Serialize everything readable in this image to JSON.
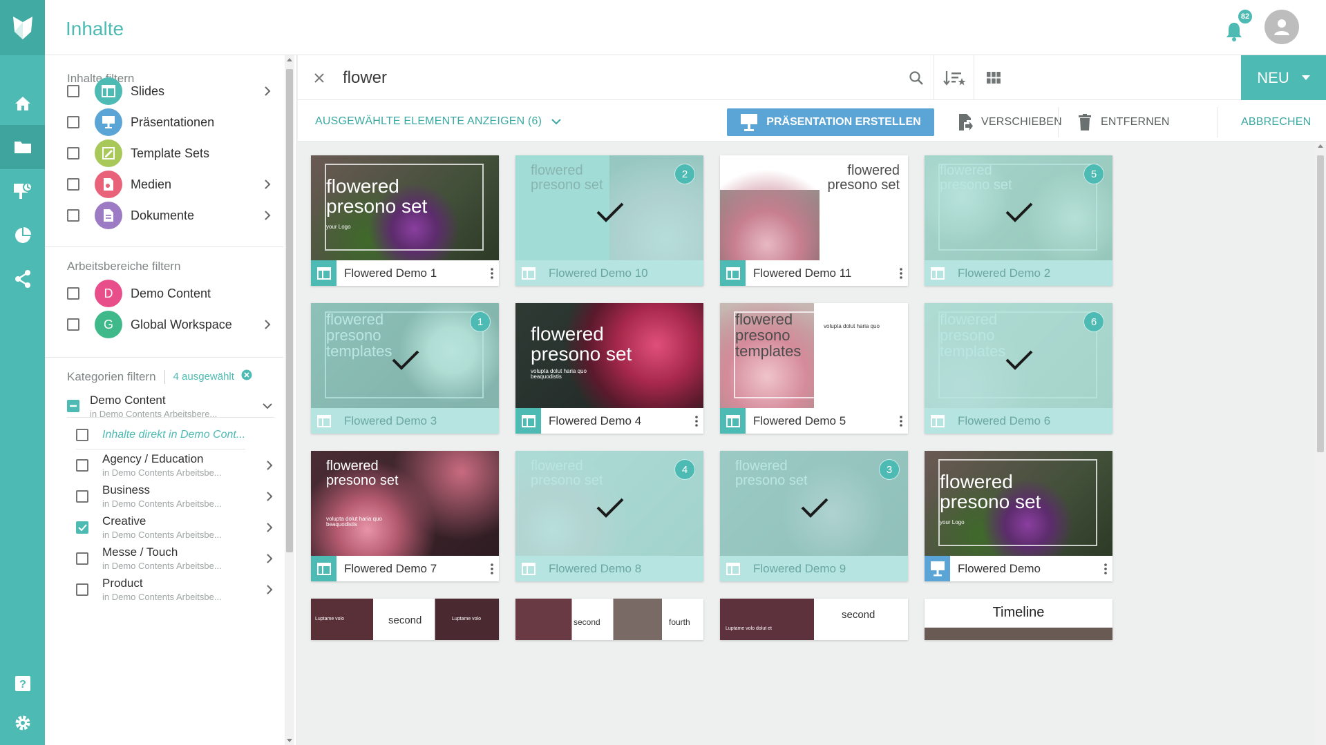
{
  "header": {
    "title": "Inhalte",
    "notification_count": "82"
  },
  "colors": {
    "accent": "#4dbab3",
    "primary_blue": "#5ba5d6",
    "selected_footer": "#b6e4e0"
  },
  "rail": {
    "icons": [
      "logo-icon",
      "home-icon",
      "folder-icon",
      "presentation-icon",
      "pie-chart-icon",
      "share-icon",
      "help-icon",
      "settings-icon"
    ]
  },
  "filters": {
    "content_title": "Inhalte filtern",
    "types": [
      {
        "label": "Slides",
        "color": "#4dbab3",
        "has_arrow": true
      },
      {
        "label": "Präsentationen",
        "color": "#5ba5d6",
        "has_arrow": false
      },
      {
        "label": "Template Sets",
        "color": "#a8c85a",
        "has_arrow": false
      },
      {
        "label": "Medien",
        "color": "#e8627a",
        "has_arrow": true
      },
      {
        "label": "Dokumente",
        "color": "#9c7bc4",
        "has_arrow": true
      }
    ],
    "workspace_title": "Arbeitsbereiche filtern",
    "workspaces": [
      {
        "label": "Demo Content",
        "letter": "D",
        "color": "#e84f8a",
        "has_arrow": false
      },
      {
        "label": "Global Workspace",
        "letter": "G",
        "color": "#3fb88a",
        "has_arrow": true
      }
    ],
    "category_title": "Kategorien filtern",
    "category_selected": "4 ausgewählt",
    "category_parent": {
      "name": "Demo Content",
      "sub": "in Demo Contents Arbeitsbere..."
    },
    "category_direct": "Inhalte direkt in Demo Cont...",
    "categories": [
      {
        "name": "Agency / Education",
        "sub": "in Demo Contents Arbeitsbe...",
        "checked": false
      },
      {
        "name": "Business",
        "sub": "in Demo Contents Arbeitsbe...",
        "checked": false
      },
      {
        "name": "Creative",
        "sub": "in Demo Contents Arbeitsbe...",
        "checked": true
      },
      {
        "name": "Messe / Touch",
        "sub": "in Demo Contents Arbeitsbe...",
        "checked": false
      },
      {
        "name": "Product",
        "sub": "in Demo Contents Arbeitsbe...",
        "checked": false
      }
    ]
  },
  "search": {
    "value": "flower",
    "new_label": "NEU"
  },
  "actions": {
    "show_selected": "AUSGEWÄHLTE ELEMENTE ANZEIGEN (6)",
    "create_presentation": "PRÄSENTATION ERSTELLEN",
    "move": "VERSCHIEBEN",
    "remove": "ENTFERNEN",
    "cancel": "ABBRECHEN"
  },
  "cards": [
    {
      "title": "Flowered Demo 1",
      "kind": "slide",
      "selected": false,
      "order": "",
      "thumb": "a",
      "text": [
        "flowered",
        "presono set"
      ],
      "small": "your Logo"
    },
    {
      "title": "Flowered Demo 10",
      "kind": "slide",
      "selected": true,
      "order": "2",
      "thumb": "b",
      "text": [
        "flowered",
        "presono set"
      ],
      "small": ""
    },
    {
      "title": "Flowered Demo 11",
      "kind": "slide",
      "selected": false,
      "order": "",
      "thumb": "c",
      "text": [
        "flowered",
        "presono set"
      ],
      "small": ""
    },
    {
      "title": "Flowered Demo 2",
      "kind": "slide",
      "selected": true,
      "order": "5",
      "thumb": "d",
      "text": [
        "flowered",
        "presono set"
      ],
      "small": ""
    },
    {
      "title": "Flowered Demo 3",
      "kind": "slide",
      "selected": true,
      "order": "1",
      "thumb": "e",
      "text": [
        "flowered",
        "presono",
        "templates"
      ],
      "small": ""
    },
    {
      "title": "Flowered Demo 4",
      "kind": "slide",
      "selected": false,
      "order": "",
      "thumb": "f",
      "text": [
        "flowered",
        "presono set"
      ],
      "small": "volupta dolut haria quo beaquodistis"
    },
    {
      "title": "Flowered Demo 5",
      "kind": "slide",
      "selected": false,
      "order": "",
      "thumb": "g",
      "text": [
        "flowered",
        "presono",
        "templates"
      ],
      "small": "volupta dolut haria quo"
    },
    {
      "title": "Flowered Demo 6",
      "kind": "slide",
      "selected": true,
      "order": "6",
      "thumb": "h",
      "text": [
        "flowered",
        "presono",
        "templates"
      ],
      "small": ""
    },
    {
      "title": "Flowered Demo 7",
      "kind": "slide",
      "selected": false,
      "order": "",
      "thumb": "i",
      "text": [
        "flowered",
        "presono set"
      ],
      "small": "volupta dolut haria quo beaquodistis"
    },
    {
      "title": "Flowered Demo 8",
      "kind": "slide",
      "selected": true,
      "order": "4",
      "thumb": "j",
      "text": [
        "flowered",
        "presono set"
      ],
      "small": ""
    },
    {
      "title": "Flowered Demo 9",
      "kind": "slide",
      "selected": true,
      "order": "3",
      "thumb": "k",
      "text": [
        "flowered",
        "presono set"
      ],
      "small": ""
    },
    {
      "title": "Flowered Demo",
      "kind": "presentation",
      "selected": false,
      "order": "",
      "thumb": "a",
      "text": [
        "flowered",
        "presono set"
      ],
      "small": "your Logo"
    }
  ],
  "partial_cards": [
    {
      "texts": [
        "Luptame volo",
        "second",
        "Luptame volo"
      ]
    },
    {
      "texts": [
        "second",
        "fourth"
      ]
    },
    {
      "texts": [
        "Luptame volo dolut et",
        "second"
      ]
    },
    {
      "texts": [
        "Timeline"
      ]
    }
  ]
}
